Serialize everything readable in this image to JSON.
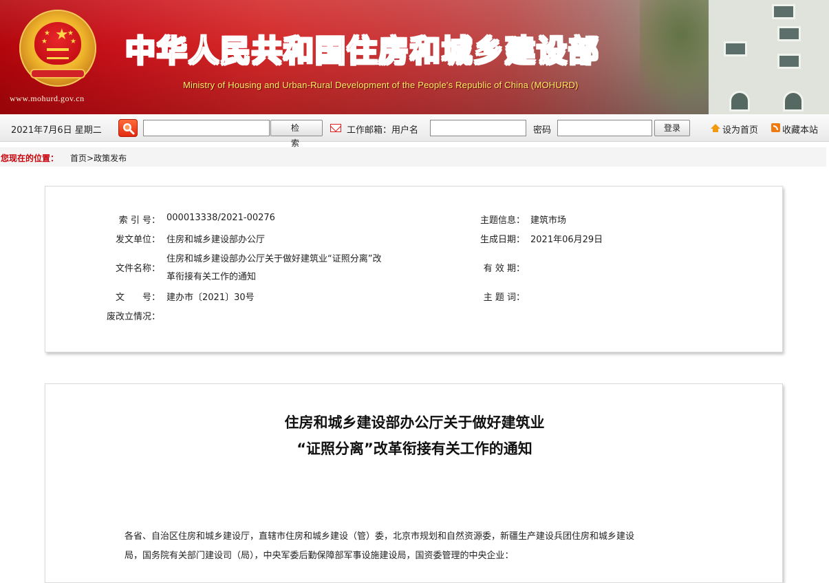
{
  "header": {
    "site_url": "www.mohurd.gov.cn",
    "title_cn": "中华人民共和国住房和城乡建设部",
    "title_en": "Ministry of Housing and Urban-Rural Development of the People's Republic of China (MOHURD)",
    "emblem": "national-emblem"
  },
  "toolbar": {
    "date": "2021年7月6日 星期二",
    "search_icon": "magnifier-icon",
    "search_value": "",
    "search_button": "检索",
    "mail_icon": "envelope-icon",
    "mail_label": "工作邮箱：用户名",
    "username_value": "",
    "password_label": "密码",
    "password_value": "",
    "login_button": "登录",
    "set_home": "设为首页",
    "bookmark": "收藏本站"
  },
  "breadcrumb": {
    "label": "您现在的位置：",
    "home": "首页",
    "separator": ">",
    "current": "政策发布"
  },
  "info": {
    "index_label": "索 引 号：",
    "index_value": "000013338/2021-00276",
    "issuer_label": "发文单位：",
    "issuer_value": "住房和城乡建设部办公厅",
    "filename_label": "文件名称：",
    "filename_line1": "住房和城乡建设部办公厅关于做好建筑业“证照分离”改",
    "filename_line2": "革衔接有关工作的通知",
    "docno_label": "文　　号：",
    "docno_value": "建办市〔2021〕30号",
    "status_label": "废改立情况：",
    "status_value": "",
    "topic_label": "主题信息：",
    "topic_value": "建筑市场",
    "date_label": "生成日期：",
    "date_value": "2021年06月29日",
    "validity_label": "有 效 期：",
    "validity_value": "",
    "keywords_label": "主 题 词：",
    "keywords_value": ""
  },
  "document": {
    "title_line1": "住房和城乡建设部办公厅关于做好建筑业",
    "title_line2": "“证照分离”改革衔接有关工作的通知",
    "body_line1": "各省、自治区住房和城乡建设厅，直辖市住房和城乡建设（管）委，北京市规划和自然资源委，新疆生产建设兵团住房和城乡建设",
    "body_line2": "局，国务院有关部门建设司（局），中央军委后勤保障部军事设施建设局，国资委管理的中央企业："
  },
  "colors": {
    "banner_red": "#c9121a",
    "title_red": "#d41a12",
    "subtitle_yellow": "#fff36a",
    "breadcrumb_red": "#c8000a"
  }
}
